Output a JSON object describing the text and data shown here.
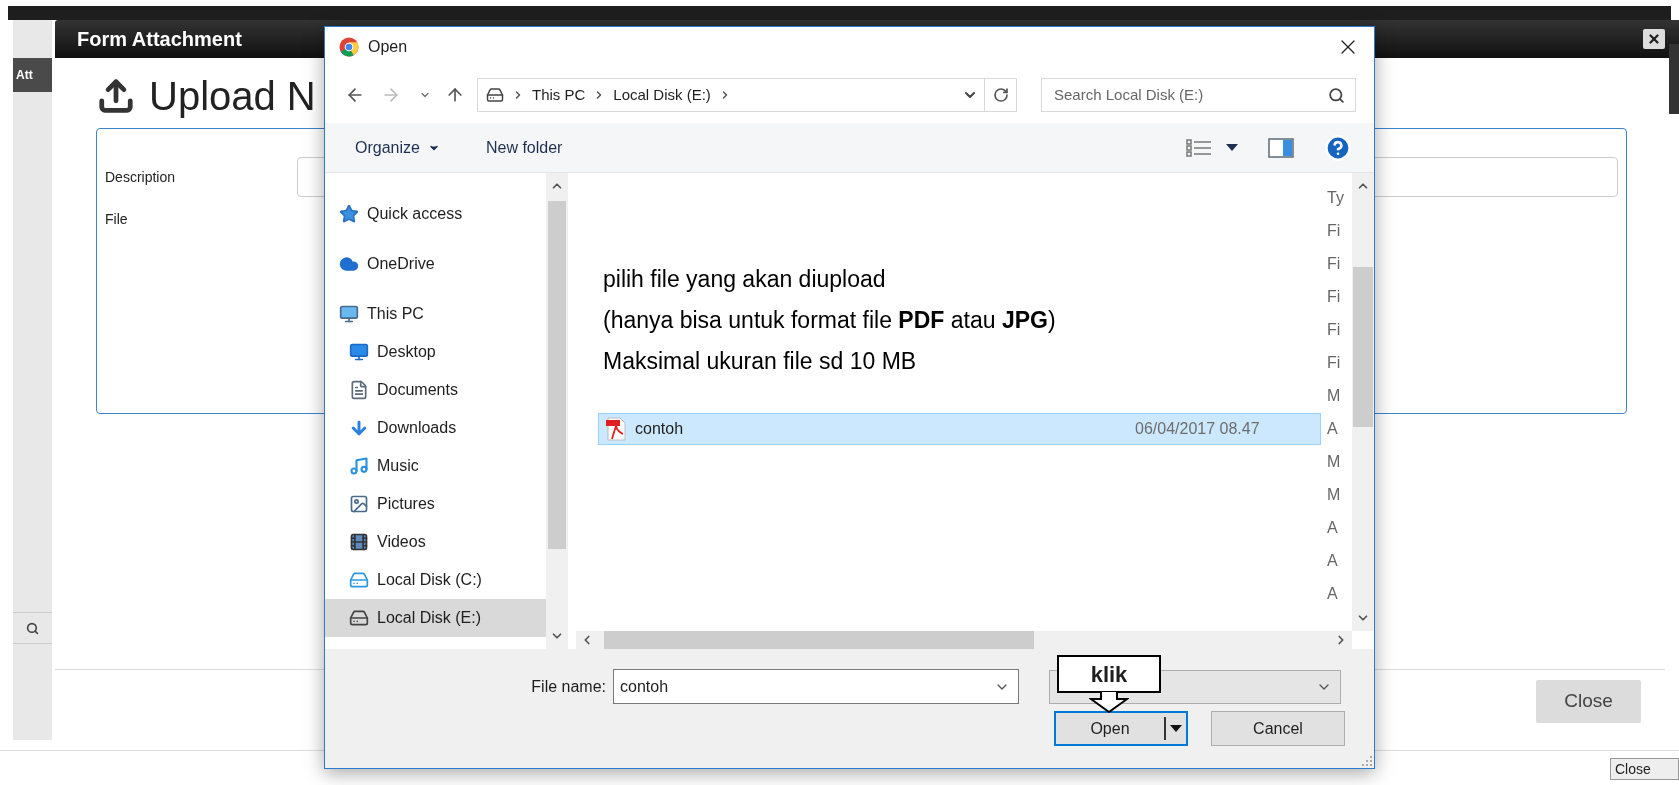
{
  "page": {
    "modal": {
      "title": "Form Attachment",
      "side_tab": "Att",
      "heading": "Upload N",
      "form": {
        "fields": [
          {
            "label": "Description",
            "kind": "text"
          },
          {
            "label": "File",
            "kind": "file"
          }
        ]
      },
      "close_button": "Close"
    },
    "footer_button": "Close"
  },
  "dialog": {
    "title": "Open",
    "path": [
      "This PC",
      "Local Disk (E:)"
    ],
    "search": {
      "placeholder": "Search Local Disk (E:)"
    },
    "toolbar": {
      "organize": "Organize",
      "new_folder": "New folder"
    },
    "nav": [
      {
        "label": "Quick access",
        "kind": "star",
        "selected": false
      },
      {
        "label": "OneDrive",
        "kind": "cloud",
        "selected": false
      },
      {
        "label": "This PC",
        "kind": "monitor",
        "selected": false,
        "children": [
          {
            "label": "Desktop",
            "kind": "desktop",
            "selected": false
          },
          {
            "label": "Documents",
            "kind": "document",
            "selected": false
          },
          {
            "label": "Downloads",
            "kind": "download",
            "selected": false
          },
          {
            "label": "Music",
            "kind": "music",
            "selected": false
          },
          {
            "label": "Pictures",
            "kind": "picture",
            "selected": false
          },
          {
            "label": "Videos",
            "kind": "video",
            "selected": false
          },
          {
            "label": "Local Disk (C:)",
            "kind": "system",
            "selected": false
          },
          {
            "label": "Local Disk (E:)",
            "kind": "disk",
            "selected": true
          }
        ]
      }
    ],
    "file_list": {
      "type_header": "Ty",
      "rows": [
        {
          "type": "Fi",
          "selected": false
        },
        {
          "type": "Fi",
          "selected": false
        },
        {
          "type": "Fi",
          "selected": false
        },
        {
          "type": "Fi",
          "selected": false
        },
        {
          "type": "Fi",
          "selected": false
        },
        {
          "type": "M",
          "selected": false
        },
        {
          "name": "contoh",
          "date": "06/04/2017 08.47",
          "type": "A",
          "selected": true
        },
        {
          "type": "M",
          "selected": false
        },
        {
          "type": "M",
          "selected": false
        },
        {
          "type": "A",
          "selected": false
        },
        {
          "type": "A",
          "selected": false
        },
        {
          "type": "A",
          "selected": false
        }
      ]
    },
    "annotation": [
      "pilih file yang akan diupload",
      "(hanya bisa untuk format file **PDF** atau **JPG**)",
      "Maksimal ukuran file sd 10 MB"
    ],
    "file_name": {
      "label": "File name:",
      "value": "contoh"
    },
    "buttons": {
      "open": "Open",
      "cancel": "Cancel"
    },
    "callout": "klik"
  }
}
